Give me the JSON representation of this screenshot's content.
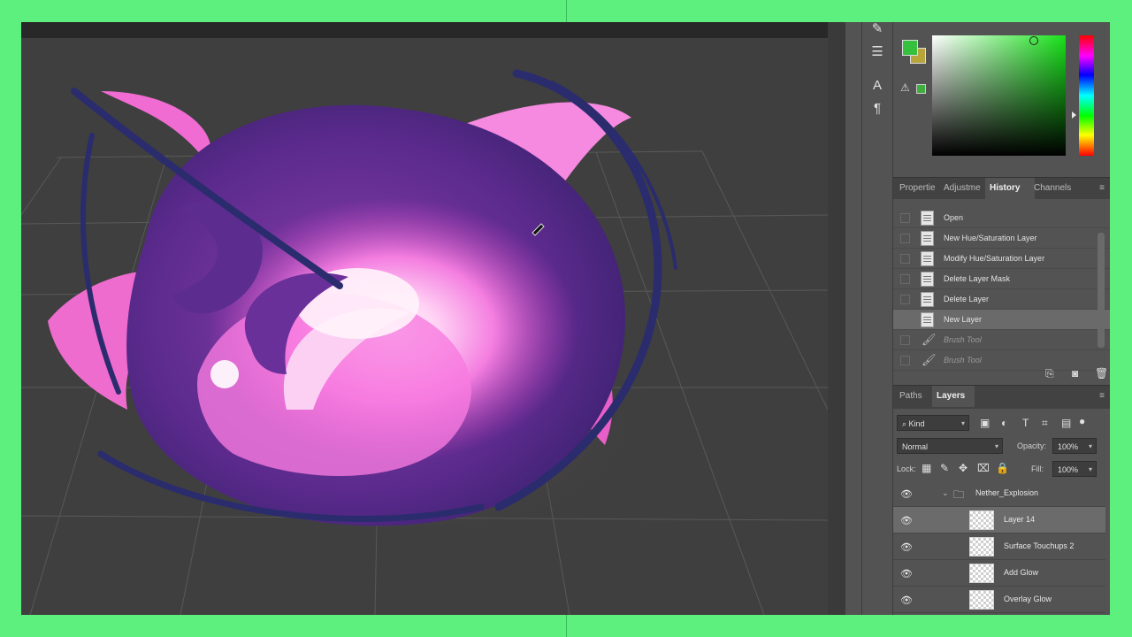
{
  "history": {
    "tabs": [
      "Propertie",
      "Adjustme",
      "History",
      "Channels"
    ],
    "active_tab": "History",
    "items": [
      {
        "label": "Open",
        "icon": "document-icon",
        "active": false,
        "future": false
      },
      {
        "label": "New Hue/Saturation Layer",
        "icon": "document-icon",
        "active": false,
        "future": false
      },
      {
        "label": "Modify Hue/Saturation Layer",
        "icon": "document-icon",
        "active": false,
        "future": false
      },
      {
        "label": "Delete Layer Mask",
        "icon": "document-icon",
        "active": false,
        "future": false
      },
      {
        "label": "Delete Layer",
        "icon": "document-icon",
        "active": false,
        "future": false
      },
      {
        "label": "New Layer",
        "icon": "document-icon",
        "active": true,
        "future": false
      },
      {
        "label": "Brush Tool",
        "icon": "brush-icon",
        "active": false,
        "future": true
      },
      {
        "label": "Brush Tool",
        "icon": "brush-icon",
        "active": false,
        "future": true
      }
    ]
  },
  "layers": {
    "tabs": [
      "Paths",
      "Layers"
    ],
    "active_tab": "Layers",
    "filter": "Kind",
    "blend_mode": "Normal",
    "opacity_label": "Opacity:",
    "opacity": "100%",
    "lock_label": "Lock:",
    "fill_label": "Fill:",
    "fill": "100%",
    "group": "Nether_Explosion",
    "items": [
      {
        "name": "Layer 14",
        "active": true
      },
      {
        "name": "Surface Touchups 2",
        "active": false
      },
      {
        "name": "Add Glow",
        "active": false
      },
      {
        "name": "Overlay Glow",
        "active": false
      }
    ]
  },
  "colors": {
    "foreground": "#35c03d",
    "background": "#b7a43a",
    "frame": "#5ef07f",
    "canvas_bg": "#3f3f3f"
  }
}
